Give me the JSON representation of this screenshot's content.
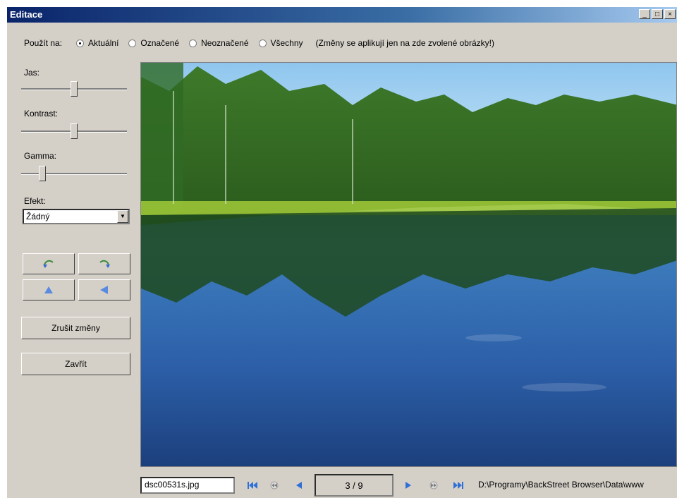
{
  "window": {
    "title": "Editace",
    "minimize_label": "_",
    "maximize_label": "□",
    "close_label": "×"
  },
  "apply": {
    "label": "Použít na:",
    "options": [
      "Aktuální",
      "Označené",
      "Neoznačené",
      "Všechny"
    ],
    "selected": "Aktuální",
    "note": "(Změny se aplikují jen na zde zvolené obrázky!)"
  },
  "sliders": {
    "brightness": {
      "label": "Jas:",
      "value": 0.5
    },
    "contrast": {
      "label": "Kontrast:",
      "value": 0.5
    },
    "gamma": {
      "label": "Gamma:",
      "value": 0.2
    }
  },
  "effect": {
    "label": "Efekt:",
    "selected": "Žádný"
  },
  "icons": {
    "rotate_left": "rotate-left-icon",
    "rotate_right": "rotate-right-icon",
    "flip_vertical": "flip-vertical-icon",
    "flip_horizontal": "flip-horizontal-icon",
    "first": "first-icon",
    "prev_fast": "rewind-icon",
    "prev": "prev-icon",
    "next": "next-icon",
    "next_fast": "fast-forward-icon",
    "last": "last-icon"
  },
  "buttons": {
    "discard": "Zrušit změny",
    "close": "Zavřít"
  },
  "footer": {
    "filename": "dsc00531s.jpg",
    "counter": "3 / 9",
    "path": "D:\\Programy\\BackStreet Browser\\Data\\www"
  },
  "colors": {
    "titlebar_start": "#0a246a",
    "titlebar_end": "#a6caf0",
    "face": "#d4d0c8",
    "nav_blue": "#2f6fd8"
  }
}
